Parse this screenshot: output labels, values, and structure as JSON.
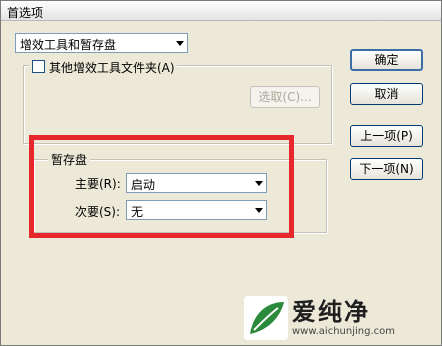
{
  "window": {
    "title": "首选项"
  },
  "section_select": {
    "value": "增效工具和暂存盘"
  },
  "plugins": {
    "checkbox_label": "其他增效工具文件夹(A)",
    "choose_button": "选取(C)..."
  },
  "scratch": {
    "legend": "暂存盘",
    "primary_label": "主要(R):",
    "primary_value": "启动",
    "secondary_label": "次要(S):",
    "secondary_value": "无"
  },
  "buttons": {
    "ok": "确定",
    "cancel": "取消",
    "prev": "上一项(P)",
    "next": "下一项(N)"
  },
  "watermark": {
    "brand": "爱纯净",
    "url": "www.aichunjing.com"
  },
  "colors": {
    "highlight": "#e6282c",
    "logo_green": "#2c8a3c"
  }
}
